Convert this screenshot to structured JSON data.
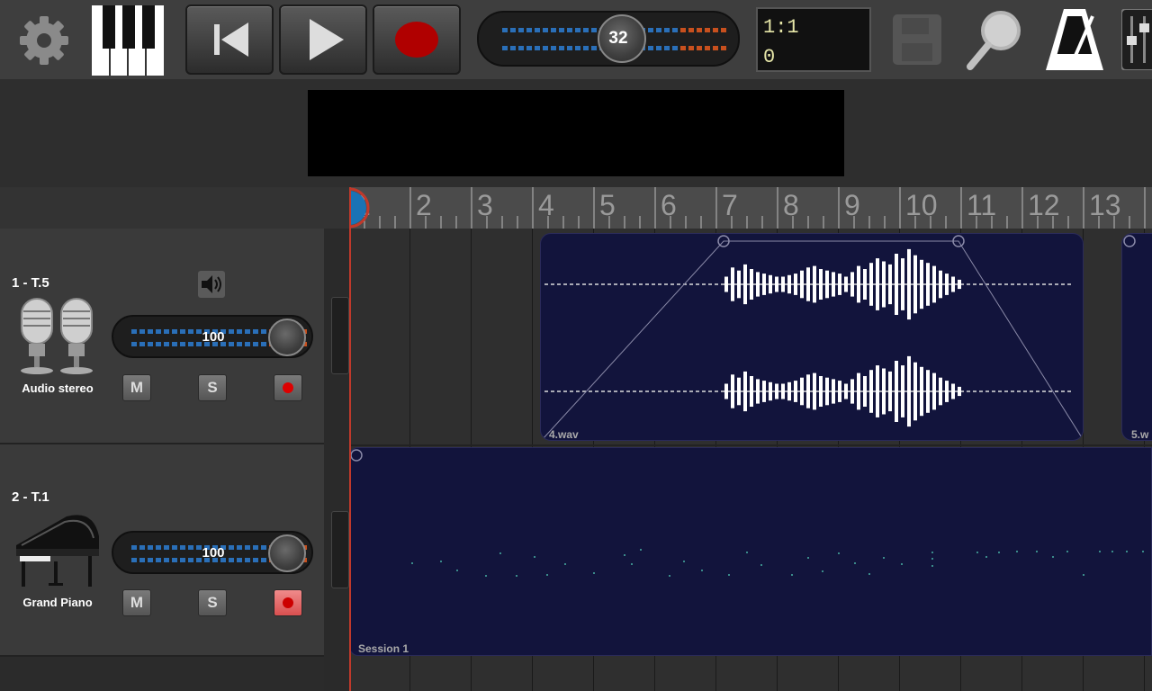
{
  "toolbar": {
    "tempo_value": "32",
    "position_bar": "1:1",
    "position_tick": "0"
  },
  "ruler": {
    "bars": [
      "1",
      "2",
      "3",
      "4",
      "5",
      "6",
      "7",
      "8",
      "9",
      "10",
      "11",
      "12",
      "13",
      "1"
    ]
  },
  "tracks": [
    {
      "name": "1 - T.5",
      "instrument": "Audio stereo",
      "volume": "100",
      "mute_label": "M",
      "solo_label": "S"
    },
    {
      "name": "2 - T.1",
      "instrument": "Grand Piano",
      "volume": "100",
      "mute_label": "M",
      "solo_label": "S"
    }
  ],
  "clips": {
    "audio1": "4.wav",
    "audio2": "5.w",
    "session": "Session 1"
  },
  "colors": {
    "accent_record": "#b00000",
    "clip_bg": "#12143c"
  }
}
